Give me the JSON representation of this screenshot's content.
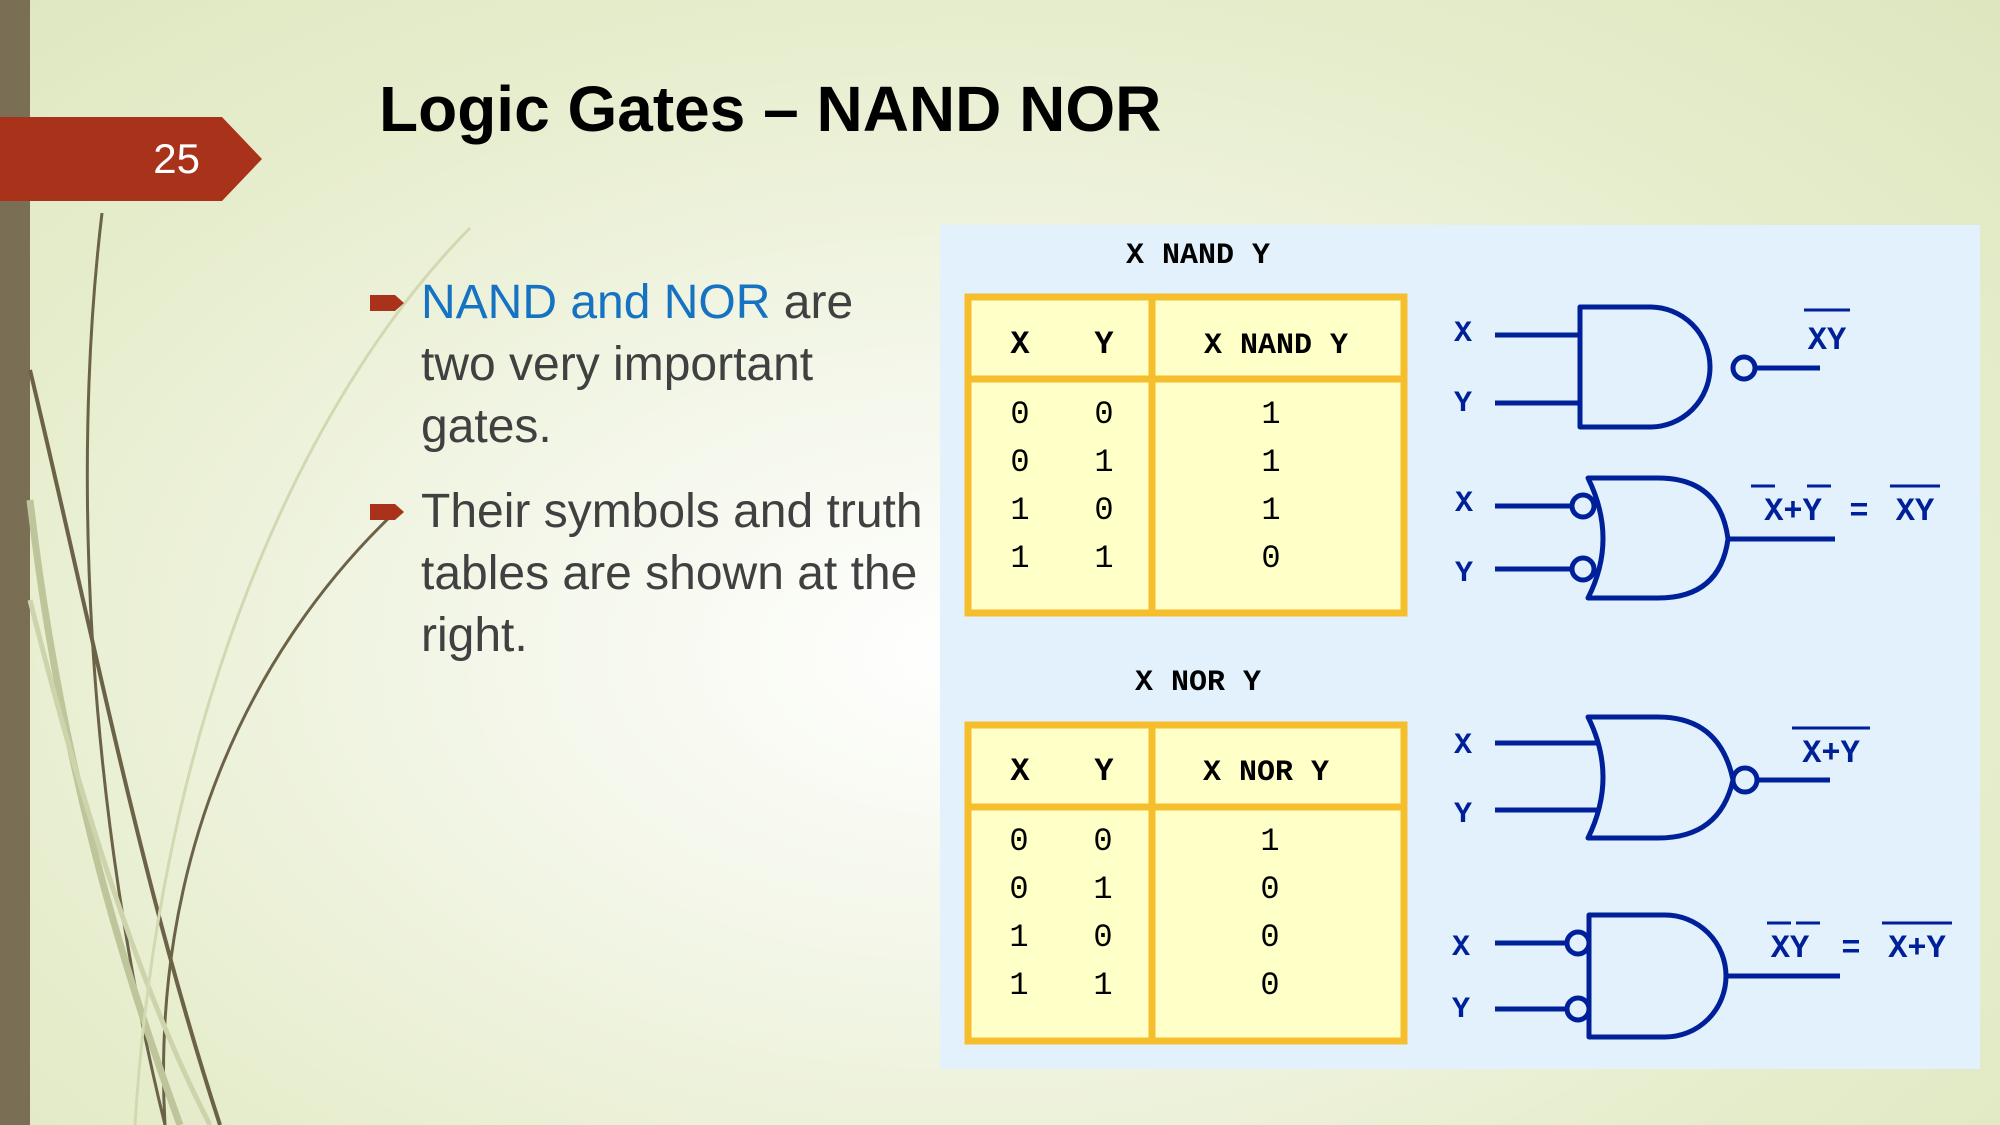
{
  "slide": {
    "number": "25",
    "title": "Logic Gates – NAND NOR"
  },
  "bullets": [
    {
      "highlight": "NAND and NOR",
      "text": " are two very important gates."
    },
    {
      "highlight": "",
      "text": "Their symbols and truth tables are shown at the right."
    }
  ],
  "colors": {
    "accent": "#a8321a",
    "highlight": "#1673c2",
    "gate_stroke": "#00209a",
    "table_border": "#f6be2c",
    "table_fill": "#ffffc8",
    "figure_bg": "#e2f1fb",
    "left_bar": "#7a6f55"
  },
  "icons": {
    "bullet": "right-arrow-bullet-icon"
  },
  "nand_table": {
    "title": "X NAND Y",
    "headers": [
      "X",
      "Y",
      "X NAND Y"
    ],
    "rows": [
      [
        "0",
        "0",
        "1"
      ],
      [
        "0",
        "1",
        "1"
      ],
      [
        "1",
        "0",
        "1"
      ],
      [
        "1",
        "1",
        "0"
      ]
    ]
  },
  "nor_table": {
    "title": "X NOR Y",
    "headers": [
      "X",
      "Y",
      "X NOR Y"
    ],
    "rows": [
      [
        "0",
        "0",
        "1"
      ],
      [
        "0",
        "1",
        "0"
      ],
      [
        "1",
        "0",
        "0"
      ],
      [
        "1",
        "1",
        "0"
      ]
    ]
  },
  "gates": [
    {
      "type": "nand",
      "inputs": [
        "X",
        "Y"
      ],
      "output": "XY",
      "output_overbar": "full"
    },
    {
      "type": "or-inverted-inputs",
      "inputs": [
        "X",
        "Y"
      ],
      "output_lhs": "X+Y",
      "output_rhs": "XY",
      "output_overbar": "partial"
    },
    {
      "type": "nor",
      "inputs": [
        "X",
        "Y"
      ],
      "output": "X+Y",
      "output_overbar": "full"
    },
    {
      "type": "and-inverted-inputs",
      "inputs": [
        "X",
        "Y"
      ],
      "output_lhs": "XY",
      "output_rhs": "X+Y",
      "output_overbar": "partial"
    }
  ]
}
